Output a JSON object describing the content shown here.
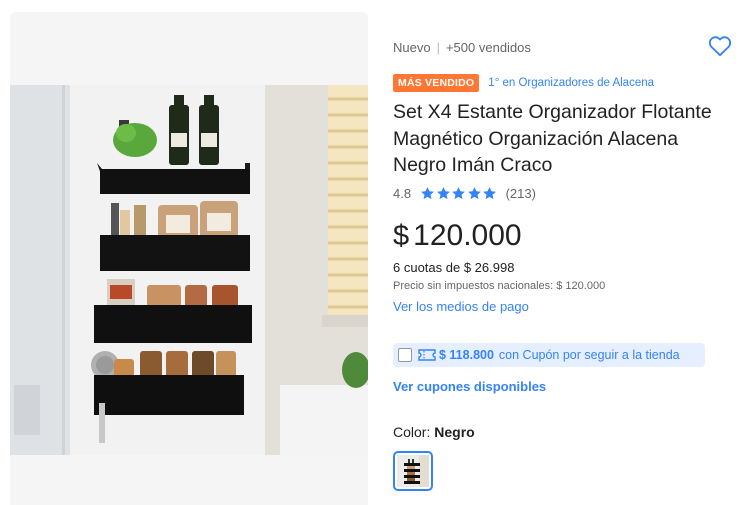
{
  "product": {
    "condition": "Nuevo",
    "sold": "+500 vendidos",
    "badge": "MÁS VENDIDO",
    "rank": "1° en Organizadores de Alacena",
    "title": "Set X4 Estante Organizador Flotante Magnético Organización Alacena Negro Imán Craco",
    "rating": "4.8",
    "rating_value": 4.8,
    "reviews": "(213)",
    "currency": "$",
    "price": "120.000",
    "installments": "6 cuotas de $ 26.998",
    "tax_note": "Precio sin impuestos nacionales: $ 120.000",
    "payment_link": "Ver los medios de pago",
    "coupon": {
      "amount": "$ 118.800",
      "text": "con Cupón por seguir a la tienda",
      "checked": false
    },
    "coupons_link": "Ver cupones disponibles",
    "color_label": "Color:",
    "color_value": "Negro"
  },
  "icons": {
    "favorite": "heart-icon",
    "star": "star-icon",
    "coupon": "ticket-icon"
  },
  "colors": {
    "accent": "#3483fa",
    "badge": "#ff7733",
    "coupon_bg": "#e6efff"
  }
}
